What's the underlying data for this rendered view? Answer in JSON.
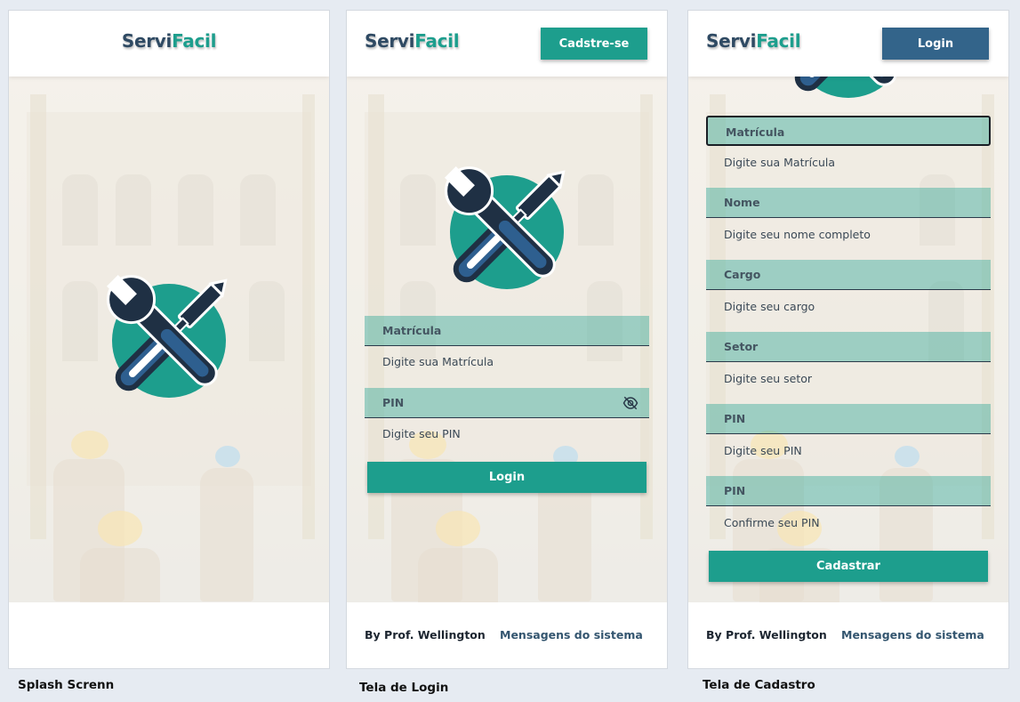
{
  "brand": {
    "part1": "Servi",
    "part2": "Facil"
  },
  "colors": {
    "teal": "#1d9e8d",
    "navy": "#33648a",
    "dark": "#2f4a63"
  },
  "splash": {
    "caption": "Splash Screnn"
  },
  "login": {
    "caption": "Tela de Login",
    "header_button": "Cadstre-se",
    "fields": [
      {
        "label": "Matrícula",
        "placeholder": "Digite sua Matrícula"
      },
      {
        "label": "PIN",
        "placeholder": "Digite seu PIN",
        "icon": "eye-off-icon"
      }
    ],
    "submit": "Login"
  },
  "signup": {
    "caption": "Tela de Cadastro",
    "header_button": "Login",
    "fields": [
      {
        "label": "Matrícula",
        "placeholder": "Digite sua Matrícula"
      },
      {
        "label": "Nome",
        "placeholder": "Digite seu nome completo"
      },
      {
        "label": "Cargo",
        "placeholder": "Digite seu cargo"
      },
      {
        "label": "Setor",
        "placeholder": "Digite seu setor"
      },
      {
        "label": "PIN",
        "placeholder": "Digite seu PIN"
      },
      {
        "label": "PIN",
        "placeholder": "Confirme seu PIN"
      }
    ],
    "submit": "Cadastrar"
  },
  "footer": {
    "author": "By Prof. Wellington",
    "messages": "Mensagens do sistema"
  }
}
